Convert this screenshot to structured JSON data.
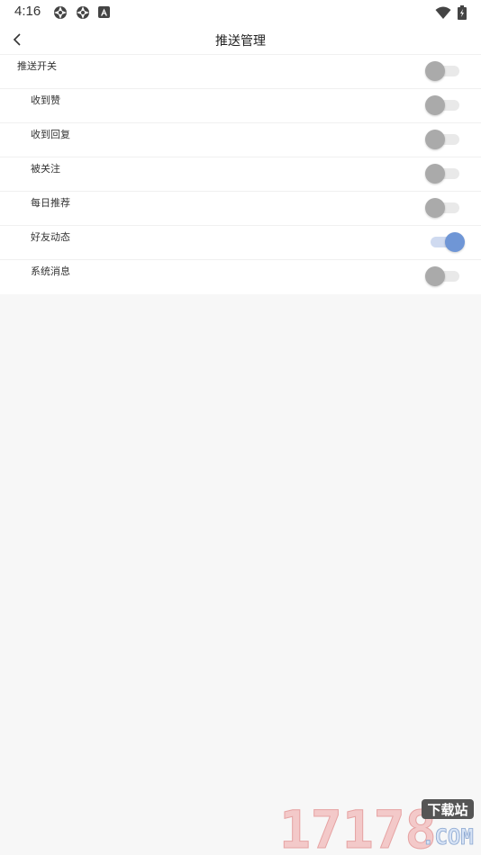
{
  "status_bar": {
    "time": "4:16",
    "icons": [
      "aperture-icon",
      "aperture-icon",
      "a-badge-icon",
      "wifi-icon",
      "battery-charging-icon"
    ]
  },
  "header": {
    "title": "推送管理",
    "back_icon": "chevron-left-icon"
  },
  "settings": [
    {
      "key": "push",
      "label": "推送开关",
      "level": "main",
      "enabled": false
    },
    {
      "key": "likes",
      "label": "收到赞",
      "level": "sub",
      "enabled": false
    },
    {
      "key": "replies",
      "label": "收到回复",
      "level": "sub",
      "enabled": false
    },
    {
      "key": "follows",
      "label": "被关注",
      "level": "sub",
      "enabled": false
    },
    {
      "key": "daily",
      "label": "每日推荐",
      "level": "sub",
      "enabled": false
    },
    {
      "key": "friends",
      "label": "好友动态",
      "level": "sub",
      "enabled": true
    },
    {
      "key": "system",
      "label": "系统消息",
      "level": "sub",
      "enabled": false
    }
  ],
  "watermark": {
    "number": "17178",
    "badge": "下载站",
    "domain": ".COM"
  },
  "colors": {
    "toggle_on": "#6f96d6",
    "toggle_off": "#aaaaaa",
    "background": "#f7f7f7"
  }
}
